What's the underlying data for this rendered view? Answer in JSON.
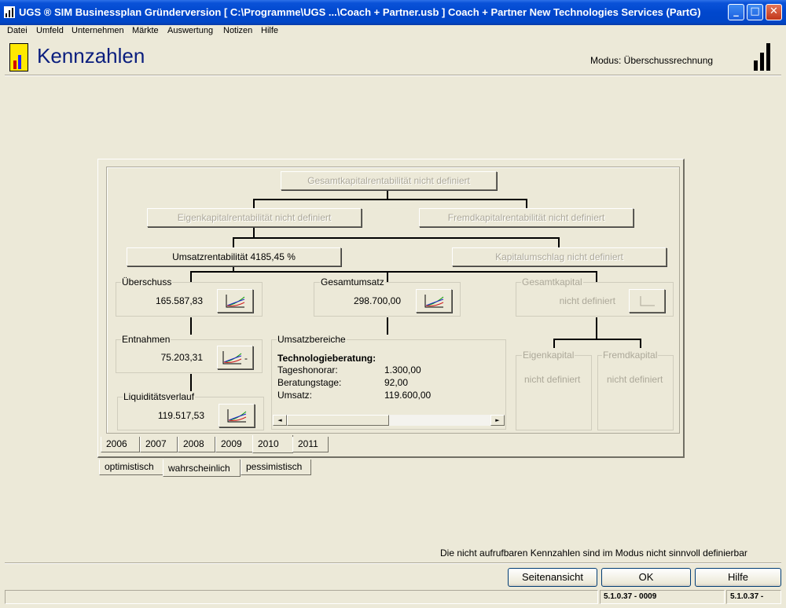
{
  "window": {
    "title": "UGS ® SIM Businessplan Gründerversion   [ C:\\Programme\\UGS ...\\Coach + Partner.usb ] Coach + Partner New Technologies Services (PartG)",
    "controls": [
      "minimize",
      "maximize",
      "close"
    ]
  },
  "menu": [
    "Datei",
    "Umfeld",
    "Unternehmen",
    "Märkte",
    "Auswertung",
    "Notizen",
    "Hilfe"
  ],
  "header": {
    "title": "Kennzahlen",
    "mode": "Modus: Überschussrechnung"
  },
  "tree": {
    "gesamtkapitalrentabilitaet": "Gesamtkapitalrentabilität nicht definiert",
    "eigenkapitalrentabilitaet": "Eigenkapitalrentabilität nicht definiert",
    "fremdkapitalrentabilitaet": "Fremdkapitalrentabilität nicht definiert",
    "umsatzrentabilitaet": "Umsatzrentabilität 4185,45 %",
    "kapitalumschlag": "Kapitalumschlag nicht definiert"
  },
  "groups": {
    "ueberschuss": {
      "label": "Überschuss",
      "value": "165.587,83"
    },
    "gesamtumsatz": {
      "label": "Gesamtumsatz",
      "value": "298.700,00"
    },
    "gesamtkapital": {
      "label": "Gesamtkapital",
      "value": "nicht definiert"
    },
    "entnahmen": {
      "label": "Entnahmen",
      "value": "75.203,31",
      "suffix": "-"
    },
    "liquiditaet": {
      "label": "Liquiditätsverlauf",
      "value": "119.517,53"
    },
    "eigenkapital": {
      "label": "Eigenkapital",
      "value": "nicht definiert"
    },
    "fremdkapital": {
      "label": "Fremdkapital",
      "value": "nicht definiert"
    }
  },
  "umsatzbereiche": {
    "label": "Umsatzbereiche",
    "heading": "Technologieberatung:",
    "rows": [
      {
        "name": "Tageshonorar:",
        "value": "1.300,00"
      },
      {
        "name": "Beratungstage:",
        "value": "92,00"
      },
      {
        "name": "Umsatz:",
        "value": "119.600,00"
      }
    ]
  },
  "year_tabs": [
    "2006",
    "2007",
    "2008",
    "2009",
    "2010",
    "2011"
  ],
  "selected_year": "2010",
  "scenario_tabs": [
    "optimistisch",
    "wahrscheinlich",
    "pessimistisch"
  ],
  "selected_scenario": "wahrscheinlich",
  "footer": {
    "note": "Die nicht aufrufbaren Kennzahlen sind im Modus nicht sinnvoll  definierbar",
    "buttons": [
      "Seitenansicht",
      "OK",
      "Hilfe"
    ],
    "status": [
      "5.1.0.37 - 0009",
      "5.1.0.37 -"
    ]
  },
  "colors": {
    "titlebar": "#0046c8",
    "heading": "#0a1e7e",
    "background": "#ece9d8"
  }
}
